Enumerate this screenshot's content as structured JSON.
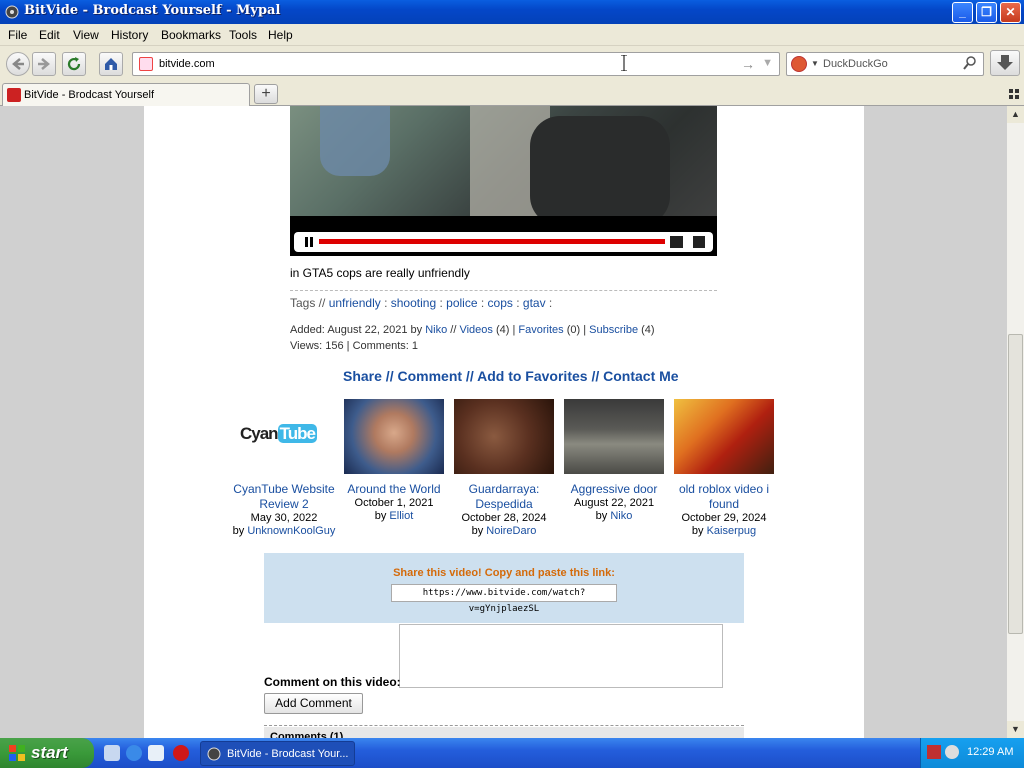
{
  "window": {
    "title": "BitVide - Brodcast Yourself - Mypal",
    "minimize": "_",
    "maximize": "❐",
    "close": "✕"
  },
  "menu": [
    "File",
    "Edit",
    "View",
    "History",
    "Bookmarks",
    "Tools",
    "Help"
  ],
  "nav": {
    "url": "bitvide.com",
    "search_placeholder": "DuckDuckGo"
  },
  "tabs": [
    {
      "label": "BitVide - Brodcast Yourself"
    }
  ],
  "newtab_label": "+",
  "video": {
    "caption": "in GTA5 cops are really unfriendly",
    "tags_label": "Tags //",
    "tags": [
      "unfriendly",
      "shooting",
      "police",
      "cops",
      "gtav"
    ],
    "added_label": "Added:",
    "added_date": "August 22, 2021",
    "by_label": "by",
    "author": "Niko",
    "videos_link": "Videos",
    "videos_count": "(4)",
    "favorites_link": "Favorites",
    "favorites_count": "(0)",
    "subscribe_link": "Subscribe",
    "subscribe_count": "(4)",
    "views_line": "Views: 156 | Comments: 1"
  },
  "actions": {
    "share": "Share",
    "comment": "Comment",
    "favorites": "Add to Favorites",
    "contact": "Contact Me",
    "sep": " // "
  },
  "related": [
    {
      "title": "CyanTube Website Review 2",
      "date": "May 30, 2022",
      "by": "by",
      "author": "UnknownKoolGuy",
      "thumb_text": "CyanTube"
    },
    {
      "title": "Around the World",
      "date": "October 1, 2021",
      "by": "by",
      "author": "Elliot"
    },
    {
      "title": "Guardarraya: Despedida",
      "date": "October 28, 2024",
      "by": "by",
      "author": "NoireDaro"
    },
    {
      "title": "Aggressive door",
      "date": "August 22, 2021",
      "by": "by",
      "author": "Niko"
    },
    {
      "title": "old roblox video i found",
      "date": "October 29, 2024",
      "by": "by",
      "author": "Kaiserpug"
    }
  ],
  "share_box": {
    "header": "Share this video! Copy and paste this link:",
    "link": "https://www.bitvide.com/watch?v=gYnjplaezSL"
  },
  "comment": {
    "label": "Comment on this video:",
    "button": "Add Comment",
    "comments_header": "Comments (1)"
  },
  "taskbar": {
    "start": "start",
    "task_label": "BitVide - Brodcast Your...",
    "time": "12:29 AM"
  },
  "colors": {
    "link": "#1a4fa0",
    "share_header": "#d46a0a",
    "share_bg": "#cde0ef",
    "progress": "#dd0000"
  }
}
